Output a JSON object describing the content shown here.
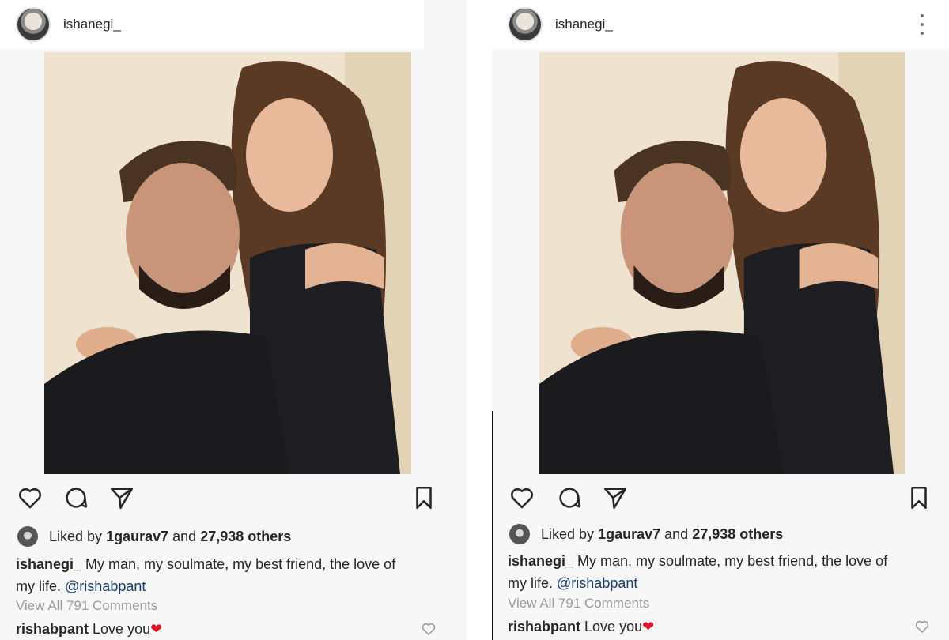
{
  "posts": [
    {
      "username": "ishanegi_",
      "liked_by_prefix": "Liked by",
      "liked_by_user": "1gaurav7",
      "liked_by_and": "and",
      "liked_by_others": "27,938 others",
      "caption_user": "ishanegi_",
      "caption_line1": "My man, my soulmate, my best friend, the love of",
      "caption_line2": "my life.",
      "caption_mention": "@rishabpant",
      "view_all_comments": "View All 791 Comments",
      "comment_user": "rishabpant",
      "comment_text": "Love you",
      "comment_emoji": "❤"
    },
    {
      "username": "ishanegi_",
      "liked_by_prefix": "Liked by",
      "liked_by_user": "1gaurav7",
      "liked_by_and": "and",
      "liked_by_others": "27,938 others",
      "caption_user": "ishanegi_",
      "caption_line1": "My man, my soulmate, my best friend, the love of",
      "caption_line2": "my life.",
      "caption_mention": "@rishabpant",
      "view_all_comments": "View All 791 Comments",
      "comment_user": "rishabpant",
      "comment_text": "Love you",
      "comment_emoji": "❤"
    }
  ],
  "icons": {
    "like": "heart-outline-icon",
    "comment": "comment-bubble-icon",
    "share": "paper-plane-icon",
    "save": "bookmark-icon",
    "more": "more-vertical-icon",
    "comment_like": "small-heart-icon"
  },
  "colors": {
    "mention": "#1a3d6d",
    "heart": "#e0162b",
    "muted": "#9a9a9a"
  }
}
